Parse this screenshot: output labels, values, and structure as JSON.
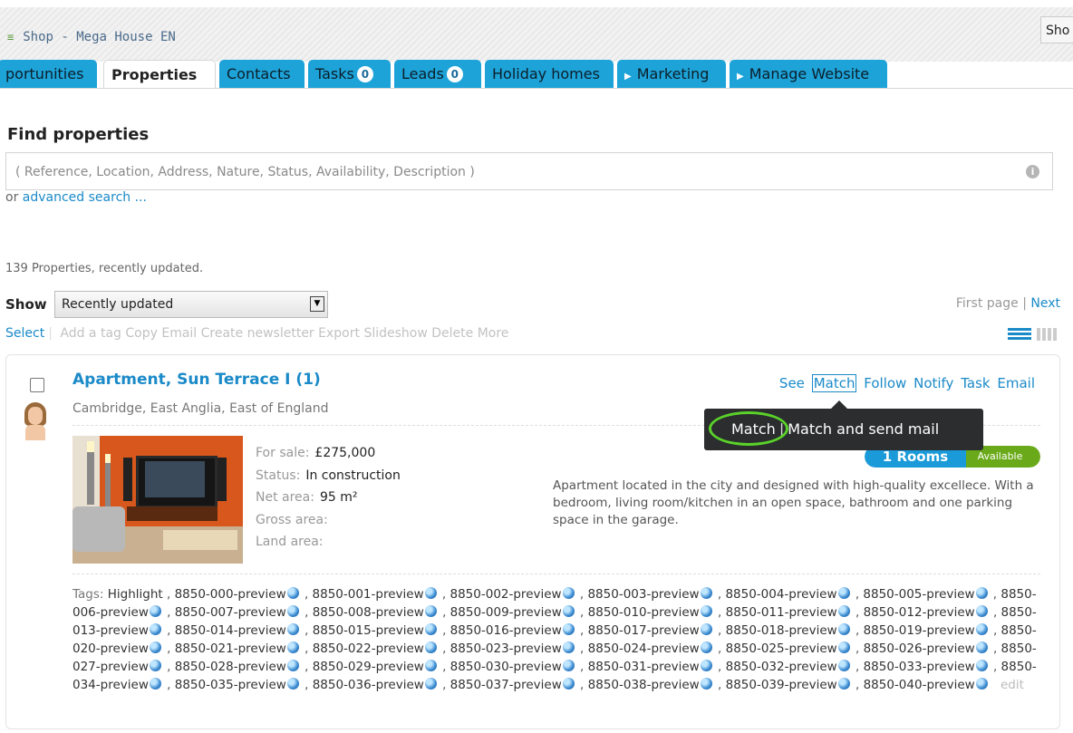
{
  "app": {
    "title": "Shop - Mega House EN",
    "shop_button": "Sho"
  },
  "tabs": [
    {
      "label": "portunities"
    },
    {
      "label": "Properties"
    },
    {
      "label": "Contacts"
    },
    {
      "label": "Tasks",
      "count": "0"
    },
    {
      "label": "Leads",
      "count": "0"
    },
    {
      "label": "Holiday homes"
    },
    {
      "label": "Marketing"
    },
    {
      "label": "Manage Website"
    }
  ],
  "search": {
    "title": "Find properties",
    "placeholder": "( Reference, Location, Address, Nature, Status, Availability, Description )",
    "or_text": "or",
    "advanced_link": "advanced search ..."
  },
  "results": {
    "count_text": "139 Properties, recently updated.",
    "show_label": "Show",
    "show_value": "Recently updated",
    "first_page": "First page",
    "pager_sep": "|",
    "next": "Next"
  },
  "actions": {
    "select": "Select",
    "sep": "|",
    "items": [
      "Add a tag",
      "Copy",
      "Email",
      "Create newsletter",
      "Export",
      "Slideshow",
      "Delete",
      "More"
    ]
  },
  "property": {
    "title": "Apartment, Sun Terrace I (1)",
    "location": "Cambridge, East Anglia, East of England",
    "actions": [
      "See",
      "Match",
      "Follow",
      "Notify",
      "Task",
      "Email"
    ],
    "facts": [
      {
        "label": "For sale:",
        "value": "£275,000"
      },
      {
        "label": "Status:",
        "value": "In construction"
      },
      {
        "label": "Net area:",
        "value": "95 m²"
      },
      {
        "label": "Gross area:",
        "value": ""
      },
      {
        "label": "Land area:",
        "value": ""
      }
    ],
    "rooms": "1 Rooms",
    "availability": "Available",
    "description": "Apartment located in the city and designed with high-quality excellece. With a bedroom, living room/kitchen in an open space, bathroom and one parking space in the garage.",
    "tags_label": "Tags:",
    "tags": [
      "Highlight",
      "8850-000-preview",
      "8850-001-preview",
      "8850-002-preview",
      "8850-003-preview",
      "8850-004-preview",
      "8850-005-preview",
      "8850-006-preview",
      "8850-007-preview",
      "8850-008-preview",
      "8850-009-preview",
      "8850-010-preview",
      "8850-011-preview",
      "8850-012-preview",
      "8850-013-preview",
      "8850-014-preview",
      "8850-015-preview",
      "8850-016-preview",
      "8850-017-preview",
      "8850-018-preview",
      "8850-019-preview",
      "8850-020-preview",
      "8850-021-preview",
      "8850-022-preview",
      "8850-023-preview",
      "8850-024-preview",
      "8850-025-preview",
      "8850-026-preview",
      "8850-027-preview",
      "8850-028-preview",
      "8850-029-preview",
      "8850-030-preview",
      "8850-031-preview",
      "8850-032-preview",
      "8850-033-preview",
      "8850-034-preview",
      "8850-035-preview",
      "8850-036-preview",
      "8850-037-preview",
      "8850-038-preview",
      "8850-039-preview",
      "8850-040-preview"
    ],
    "tags_edit": "edit"
  },
  "popup": {
    "match": "Match",
    "sep": "|",
    "match_send": "Match and send mail"
  },
  "colors": {
    "accent": "#1a8ac8",
    "tab": "#1ea3d8",
    "available": "#6aaa1a",
    "highlight_circle": "#5ad22a"
  }
}
